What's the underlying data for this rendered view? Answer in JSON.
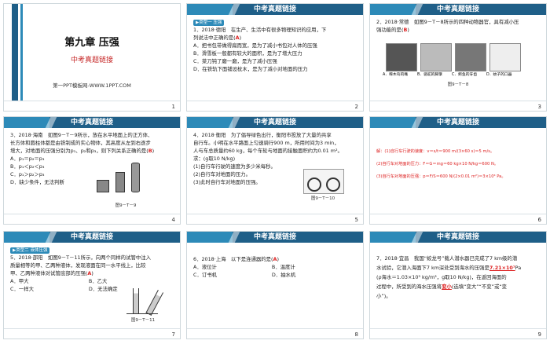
{
  "slides": [
    {
      "id": "s1",
      "title": "第九章  压强",
      "subtitle": "中考真题链接",
      "watermark": "第一PPT模板网-WWW.1PPT.COM",
      "page": "1"
    },
    {
      "id": "s2",
      "header": "中考真题链接",
      "tag": "▶类型一  压强",
      "lines": [
        "1．2018·德阳　在生产、生活中有很多物理知识的应用，下",
        "列说法中正确的是(",
        "A．把书包带做得扁而宽，是为了减小书包对人体的压强",
        "B．滑雪板一般都有较大的面积，是为了增大压力",
        "C．菜刀钝了磨一磨，是为了减小压强",
        "D．在铁轨下面铺设枕木，是为了减小对地面的压力"
      ],
      "answer": "A",
      "close": ")",
      "page": "2"
    },
    {
      "id": "s3",
      "header": "中考真题链接",
      "lines": [
        "2．2018·常德　如图9－T－8所示的四种动物器官，具有减小压",
        "强功能的是("
      ],
      "answer": "B",
      "close": ")",
      "labels": [
        "A．啄木鸟的嘴",
        "B．骆驼的脚掌",
        "C．鳄鱼的牙齿",
        "D．蚊子的口器"
      ],
      "fig": "图9－T－8",
      "page": "3"
    },
    {
      "id": "s4",
      "header": "中考真题链接",
      "lines": [
        "3．2018·海南　如图9－T－9所示，放在水平地面上的正方体、",
        "长方体和圆柱体都是由铁制成的实心物体，其高度从左到右逐步",
        "增大，对地面的压强分别为p₁、p₂和p₃，则下列关系正确的是(",
        "A．p₁＝p₂＝p₃",
        "B．p₁＜p₂＜p₃",
        "C．p₁＞p₂＞p₃",
        "D．缺少条件，无法判断"
      ],
      "answer": "B",
      "close": ")",
      "fig": "图9－T－9",
      "page": "4"
    },
    {
      "id": "s5",
      "header": "中考真题链接",
      "lines": [
        "4．2018·衡阳　为了倡导绿色出行，衡阳市投放了大量的共享",
        "自行车。小明在水平路面上匀速骑行900 m，所用时间为3 min，",
        "人与车总质量约60 kg，每个车轮与地面的接触面积约为0.01 m²。",
        "求：(g取10 N/kg)",
        "(1)自行车行驶的速度为多少米每秒。",
        "(2)自行车对地面的压力。",
        "(3)此时自行车对地面的压强。"
      ],
      "fig": "图9－T－10",
      "page": "5"
    },
    {
      "id": "s6",
      "header": "中考真题链接",
      "lines": [
        "解：(1)自行车行驶的速度：v＝s/t＝900 m/(3×60 s)＝5 m/s。",
        "(2)自行车对地面的压力：F＝G＝mg＝60 kg×10 N/kg＝600 N。",
        "(3)自行车对地面的压强：p＝F/S＝600 N/(2×0.01 m²)＝3×10⁴ Pa。"
      ],
      "page": "6"
    },
    {
      "id": "s7",
      "header": "中考真题链接",
      "tag": "▶类型二  液体压强",
      "lines": [
        "5．2018·邵阳　如图9－T－11所示，向两个同样的试管中注入",
        "质量相等的甲、乙两种液体，发现液面在同一水平线上，比较",
        "甲、乙两种液体对试管底部的压强(",
        "A．甲大",
        "B．乙大",
        "C．一样大",
        "D．无法确定"
      ],
      "answer": "A",
      "close": ")",
      "fig": "图9－T－11",
      "page": "7"
    },
    {
      "id": "s8",
      "header": "中考真题链接",
      "lines": [
        "6．2018·上海　以下是连通器的是(",
        "A．液位计",
        "B．温度计",
        "C．订书机",
        "D．抽水机"
      ],
      "answer": "A",
      "close": ")",
      "page": "8"
    },
    {
      "id": "s9",
      "header": "中考真题链接",
      "lines": [
        "7．2018·宜昌　我国“蛟龙号”载人潜水器已完成了7 km级的潜",
        "水试验，它潜入海面下7 km深处受到海水的压强是",
        "Pa",
        "(ρ海水＝1.03×10³ kg/m³，g取10 N/kg)，在返回海面的",
        "过程中，所受到的海水压强将",
        "(选填“变大”“不变”或“变",
        "小”)。"
      ],
      "blank1": "7.21×10⁷",
      "blank2": "变小",
      "page": "9"
    }
  ],
  "colors": {
    "header_bg": "#1f5f88",
    "accent": "#2d8ab8",
    "answer": "#d22222"
  }
}
